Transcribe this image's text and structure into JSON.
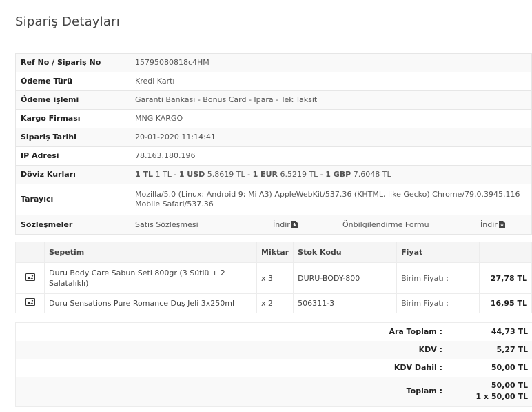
{
  "page_title": "Sipariş Detayları",
  "info": {
    "ref": {
      "label": "Ref No / Sipariş No",
      "value": "15795080818c4HM"
    },
    "payment_type": {
      "label": "Ödeme Türü",
      "value": "Kredi Kartı"
    },
    "payment_process": {
      "label": "Ödeme işlemi",
      "value": "Garanti Bankası - Bonus Card - Ipara - Tek Taksit"
    },
    "cargo": {
      "label": "Kargo Firması",
      "value": "MNG KARGO"
    },
    "order_date": {
      "label": "Sipariş Tarihi",
      "value": "20-01-2020 11:14:41"
    },
    "ip": {
      "label": "IP Adresi",
      "value": "78.163.180.196"
    },
    "currency": {
      "label": "Döviz Kurları",
      "parts": [
        {
          "strong": "1 TL",
          "text": " 1 TL - "
        },
        {
          "strong": "1 USD",
          "text": " 5.8619 TL - "
        },
        {
          "strong": "1 EUR",
          "text": " 6.5219 TL - "
        },
        {
          "strong": "1 GBP",
          "text": " 7.6048 TL"
        }
      ]
    },
    "browser": {
      "label": "Tarayıcı",
      "value": "Mozilla/5.0 (Linux; Android 9; Mi A3) AppleWebKit/537.36 (KHTML, like Gecko) Chrome/79.0.3945.116 Mobile Safari/537.36"
    },
    "contracts": {
      "label": "Sözleşmeler",
      "sales": "Satış Sözleşmesi",
      "sales_download": "İndir",
      "prelim": "Önbilgilendirme Formu",
      "prelim_download": "İndir"
    }
  },
  "items": {
    "headers": {
      "cart": "Sepetim",
      "qty": "Miktar",
      "sku": "Stok Kodu",
      "price": "Fiyat"
    },
    "rows": [
      {
        "name": "Duru Body Care Sabun Seti 800gr (3 Sütlü + 2 Salatalıklı)",
        "qty": "x 3",
        "sku": "DURU-BODY-800",
        "unit_label": "Birim Fiyatı :",
        "price": "27,78 TL"
      },
      {
        "name": "Duru Sensations Pure Romance Duş Jeli 3x250ml",
        "qty": "x 2",
        "sku": "506311-3",
        "unit_label": "Birim Fiyatı :",
        "price": "16,95 TL"
      }
    ]
  },
  "totals": {
    "subtotal_label": "Ara Toplam :",
    "subtotal": "44,73 TL",
    "kdv_label": "KDV :",
    "kdv": "5,27 TL",
    "kdv_incl_label": "KDV Dahil :",
    "kdv_incl": "50,00 TL",
    "total_label": "Toplam :",
    "total": "50,00 TL",
    "total_installment": "1 x 50,00 TL"
  }
}
